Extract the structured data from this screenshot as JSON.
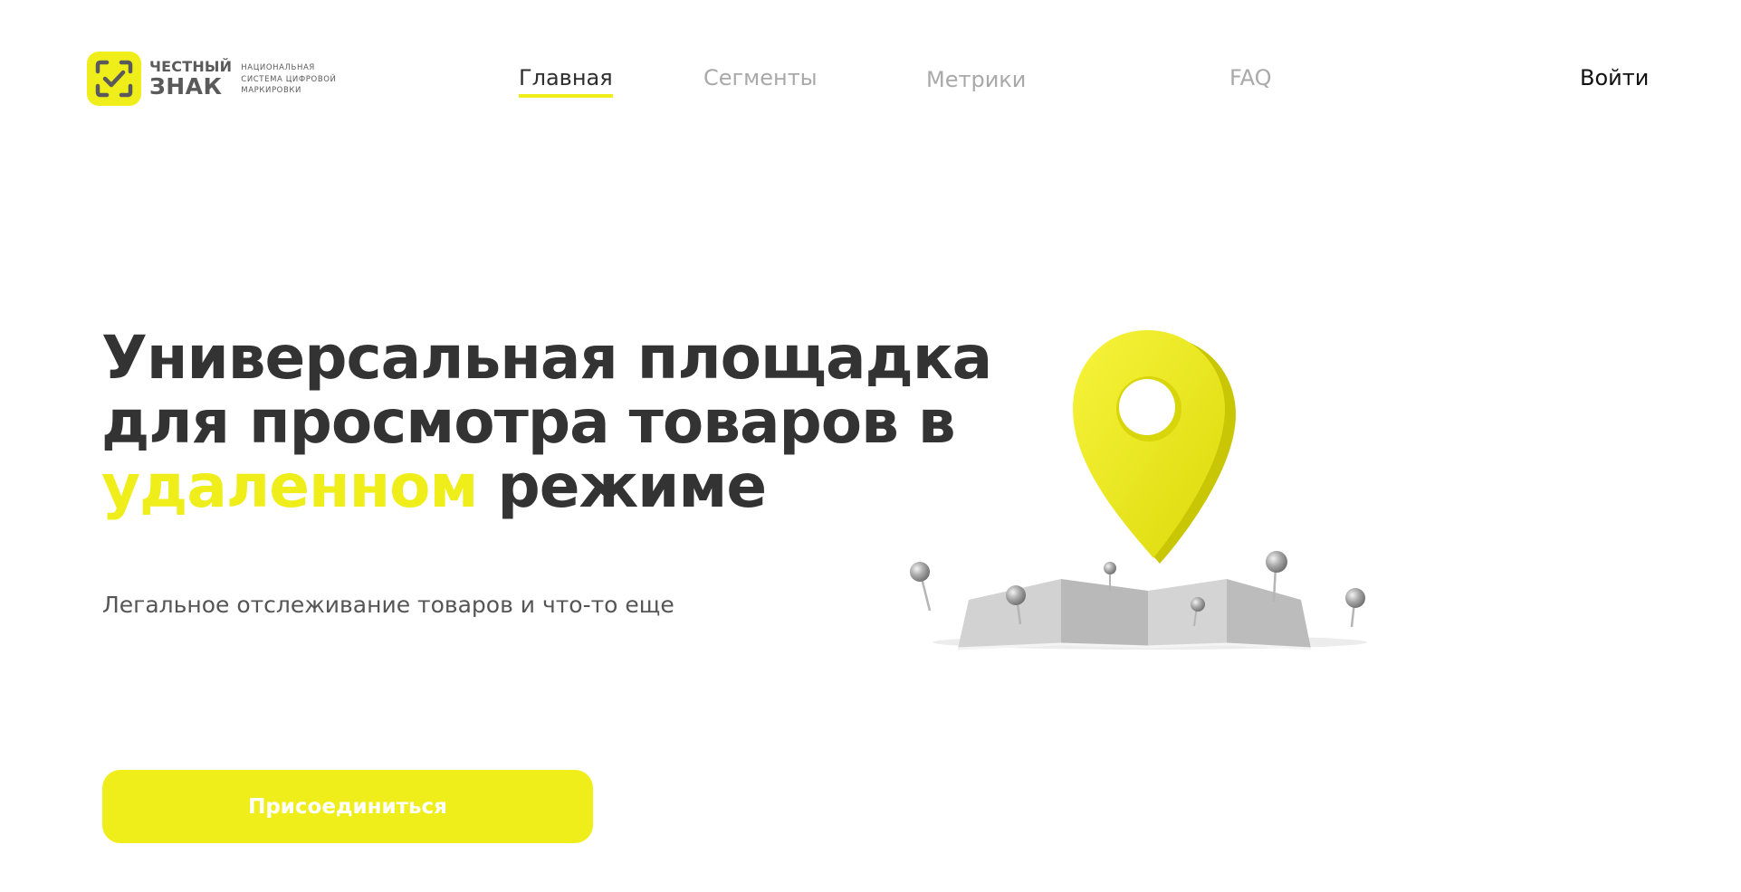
{
  "brand": {
    "name_line1": "ЧЕСТНЫЙ",
    "name_line2": "ЗНАК",
    "tagline_lines": [
      "НАЦИОНАЛЬНАЯ",
      "СИСТЕМА ЦИФРОВОЙ",
      "МАРКИРОВКИ"
    ],
    "logo_icon": "check-in-frame-icon"
  },
  "nav": {
    "items": [
      {
        "label": "Главная",
        "active": true
      },
      {
        "label": "Сегменты",
        "active": false
      },
      {
        "label": "Метрики",
        "active": false
      },
      {
        "label": "FAQ",
        "active": false
      }
    ],
    "login_label": "Войти"
  },
  "hero": {
    "title_line1": "Универсальная площадка",
    "title_line2": "для просмотра товаров в",
    "title_accent": "удаленном",
    "title_rest": " режиме",
    "subtitle": "Легальное отслеживание товаров и что-то еще",
    "cta_label": "Присоединиться",
    "illustration_icon": "location-pin-map-icon"
  },
  "colors": {
    "accent": "#f0ee1a",
    "text_dark": "#333333",
    "nav_inactive": "#a9a9a9",
    "subtitle": "#555555",
    "button_text": "#ffffff"
  }
}
